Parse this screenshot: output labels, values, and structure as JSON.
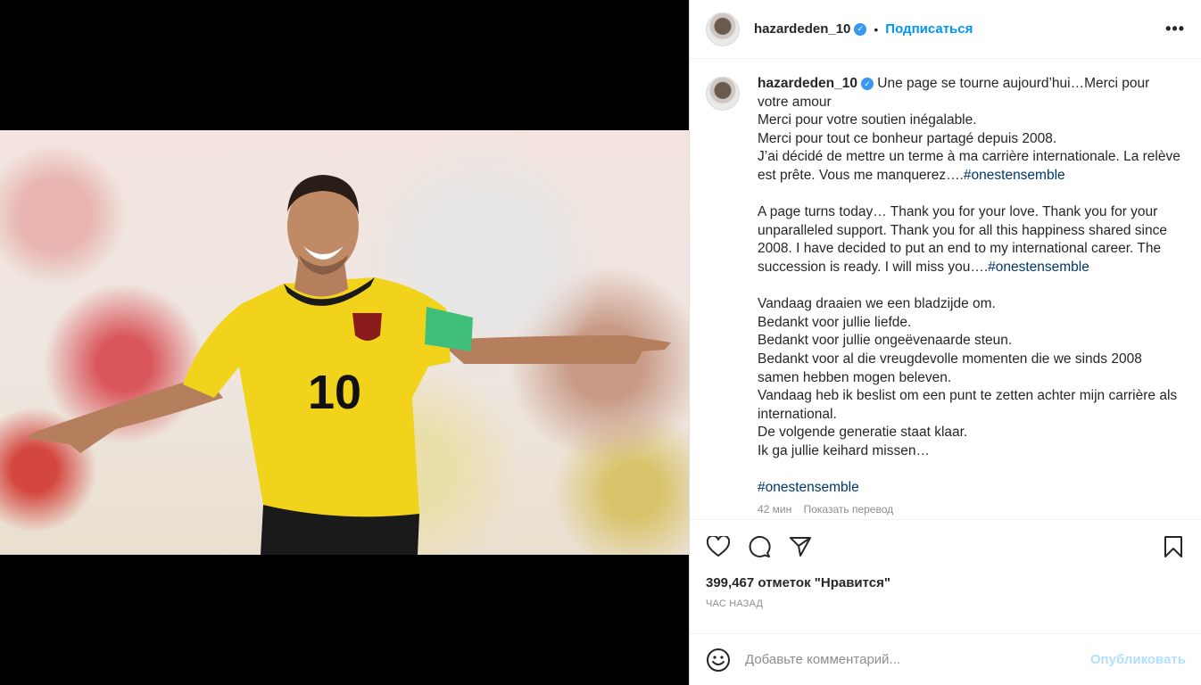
{
  "header": {
    "username": "hazardeden_10",
    "verified": true,
    "separator": "•",
    "follow_label": "Подписаться",
    "more_icon": "more-horizontal-icon",
    "more_label": "•••"
  },
  "caption": {
    "username": "hazardeden_10",
    "text_fr": " Une page se tourne aujourd’hui…Merci pour votre amour\nMerci pour votre soutien inégalable.\nMerci pour tout ce bonheur partagé depuis 2008.\nJ’ai décidé de mettre un terme à ma carrière internationale. La relève est prête. Vous me manquerez….",
    "hashtag_1": "#onestensemble",
    "text_en": "\n\nA page turns today… Thank you for your love. Thank you for your unparalleled support. Thank you for all this happiness shared since 2008. I have decided to put an end to my international career. The succession is ready. I will miss you….",
    "hashtag_2": "#onestensemble",
    "text_nl": "\n\nVandaag draaien we een bladzijde om.\nBedankt voor jullie liefde.\nBedankt voor jullie ongeëvenaarde steun.\nBedankt voor al die vreugdevolle momenten die we sinds 2008 samen hebben mogen beleven.\nVandaag heb ik beslist om een punt te zetten achter mijn carrière als international.\nDe volgende generatie staat klaar.\nIk ga jullie keihard missen…\n\n",
    "hashtag_3": "#onestensemble",
    "time_ago": "42 мин",
    "translate_label": "Показать перевод"
  },
  "actions": {
    "like_icon": "heart-icon",
    "comment_icon": "comment-icon",
    "share_icon": "paper-plane-icon",
    "save_icon": "bookmark-icon"
  },
  "likes_text": "399,467 отметок \"Нравится\"",
  "posted": "ЧАС НАЗАД",
  "comment": {
    "emoji_icon": "emoji-icon",
    "placeholder": "Добавьте комментарий...",
    "publish_label": "Опубликовать"
  },
  "colors": {
    "link_blue": "#0095f6",
    "hashtag": "#00376b",
    "publish_disabled": "#b2dffc",
    "jersey_yellow": "#f2d31b"
  }
}
